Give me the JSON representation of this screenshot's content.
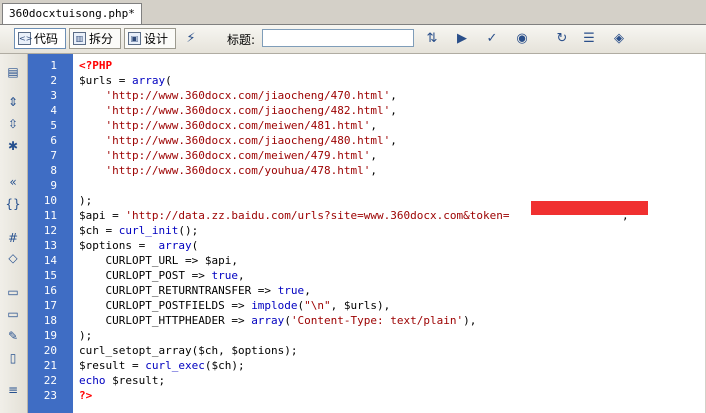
{
  "tab": {
    "filename": "360docxtuisong.php*"
  },
  "toolbar": {
    "view_code": "代码",
    "view_split": "拆分",
    "view_design": "设计",
    "title_label": "标题:",
    "title_value": ""
  },
  "colors": {
    "gutter": "#3f6dc4",
    "keyword": "#0000c0",
    "string": "#9c0000",
    "php_tag": "#ff0000"
  },
  "lines": [
    {
      "n": "1",
      "segs": [
        {
          "t": "<?PHP",
          "c": "tag"
        }
      ]
    },
    {
      "n": "2",
      "segs": [
        {
          "t": "$urls = ",
          "c": "plain"
        },
        {
          "t": "array",
          "c": "kw"
        },
        {
          "t": "(",
          "c": "plain"
        }
      ]
    },
    {
      "n": "3",
      "segs": [
        {
          "t": "    ",
          "c": "plain"
        },
        {
          "t": "'http://www.360docx.com/jiaocheng/470.html'",
          "c": "str"
        },
        {
          "t": ",",
          "c": "plain"
        }
      ]
    },
    {
      "n": "4",
      "segs": [
        {
          "t": "    ",
          "c": "plain"
        },
        {
          "t": "'http://www.360docx.com/jiaocheng/482.html'",
          "c": "str"
        },
        {
          "t": ",",
          "c": "plain"
        }
      ]
    },
    {
      "n": "5",
      "segs": [
        {
          "t": "    ",
          "c": "plain"
        },
        {
          "t": "'http://www.360docx.com/meiwen/481.html'",
          "c": "str"
        },
        {
          "t": ",",
          "c": "plain"
        }
      ]
    },
    {
      "n": "6",
      "segs": [
        {
          "t": "    ",
          "c": "plain"
        },
        {
          "t": "'http://www.360docx.com/jiaocheng/480.html'",
          "c": "str"
        },
        {
          "t": ",",
          "c": "plain"
        }
      ]
    },
    {
      "n": "7",
      "segs": [
        {
          "t": "    ",
          "c": "plain"
        },
        {
          "t": "'http://www.360docx.com/meiwen/479.html'",
          "c": "str"
        },
        {
          "t": ",",
          "c": "plain"
        }
      ]
    },
    {
      "n": "8",
      "segs": [
        {
          "t": "    ",
          "c": "plain"
        },
        {
          "t": "'http://www.360docx.com/youhua/478.html'",
          "c": "str"
        },
        {
          "t": ",",
          "c": "plain"
        }
      ]
    },
    {
      "n": "9",
      "segs": []
    },
    {
      "n": "10",
      "segs": [
        {
          "t": ");",
          "c": "plain"
        }
      ]
    },
    {
      "n": "11",
      "segs": [
        {
          "t": "$api = ",
          "c": "plain"
        },
        {
          "t": "'http://data.zz.baidu.com/urls?site=www.360docx.com&token=",
          "c": "str"
        },
        {
          "t": "                ",
          "c": "plain"
        },
        {
          "t": " ;",
          "c": "plain"
        }
      ]
    },
    {
      "n": "12",
      "segs": [
        {
          "t": "$ch = ",
          "c": "plain"
        },
        {
          "t": "curl_init",
          "c": "kw"
        },
        {
          "t": "();",
          "c": "plain"
        }
      ]
    },
    {
      "n": "13",
      "segs": [
        {
          "t": "$options =  ",
          "c": "plain"
        },
        {
          "t": "array",
          "c": "kw"
        },
        {
          "t": "(",
          "c": "plain"
        }
      ]
    },
    {
      "n": "14",
      "segs": [
        {
          "t": "    CURLOPT_URL => $api,",
          "c": "plain"
        }
      ]
    },
    {
      "n": "15",
      "segs": [
        {
          "t": "    CURLOPT_POST => ",
          "c": "plain"
        },
        {
          "t": "true",
          "c": "kw"
        },
        {
          "t": ",",
          "c": "plain"
        }
      ]
    },
    {
      "n": "16",
      "segs": [
        {
          "t": "    CURLOPT_RETURNTRANSFER => ",
          "c": "plain"
        },
        {
          "t": "true",
          "c": "kw"
        },
        {
          "t": ",",
          "c": "plain"
        }
      ]
    },
    {
      "n": "17",
      "segs": [
        {
          "t": "    CURLOPT_POSTFIELDS => ",
          "c": "plain"
        },
        {
          "t": "implode",
          "c": "kw"
        },
        {
          "t": "(",
          "c": "plain"
        },
        {
          "t": "\"\\n\"",
          "c": "str"
        },
        {
          "t": ", $urls),",
          "c": "plain"
        }
      ]
    },
    {
      "n": "18",
      "segs": [
        {
          "t": "    CURLOPT_HTTPHEADER => ",
          "c": "plain"
        },
        {
          "t": "array",
          "c": "kw"
        },
        {
          "t": "(",
          "c": "plain"
        },
        {
          "t": "'Content-Type: text/plain'",
          "c": "str"
        },
        {
          "t": "),",
          "c": "plain"
        }
      ]
    },
    {
      "n": "19",
      "segs": [
        {
          "t": ");",
          "c": "plain"
        }
      ]
    },
    {
      "n": "20",
      "segs": [
        {
          "t": "curl_setopt_array($ch, $options);",
          "c": "plain"
        }
      ]
    },
    {
      "n": "21",
      "segs": [
        {
          "t": "$result = ",
          "c": "plain"
        },
        {
          "t": "curl_exec",
          "c": "kw"
        },
        {
          "t": "($ch);",
          "c": "plain"
        }
      ]
    },
    {
      "n": "22",
      "segs": [
        {
          "t": "echo",
          "c": "kw"
        },
        {
          "t": " $result;",
          "c": "plain"
        }
      ]
    },
    {
      "n": "23",
      "segs": [
        {
          "t": "?>",
          "c": "tag"
        }
      ]
    }
  ]
}
